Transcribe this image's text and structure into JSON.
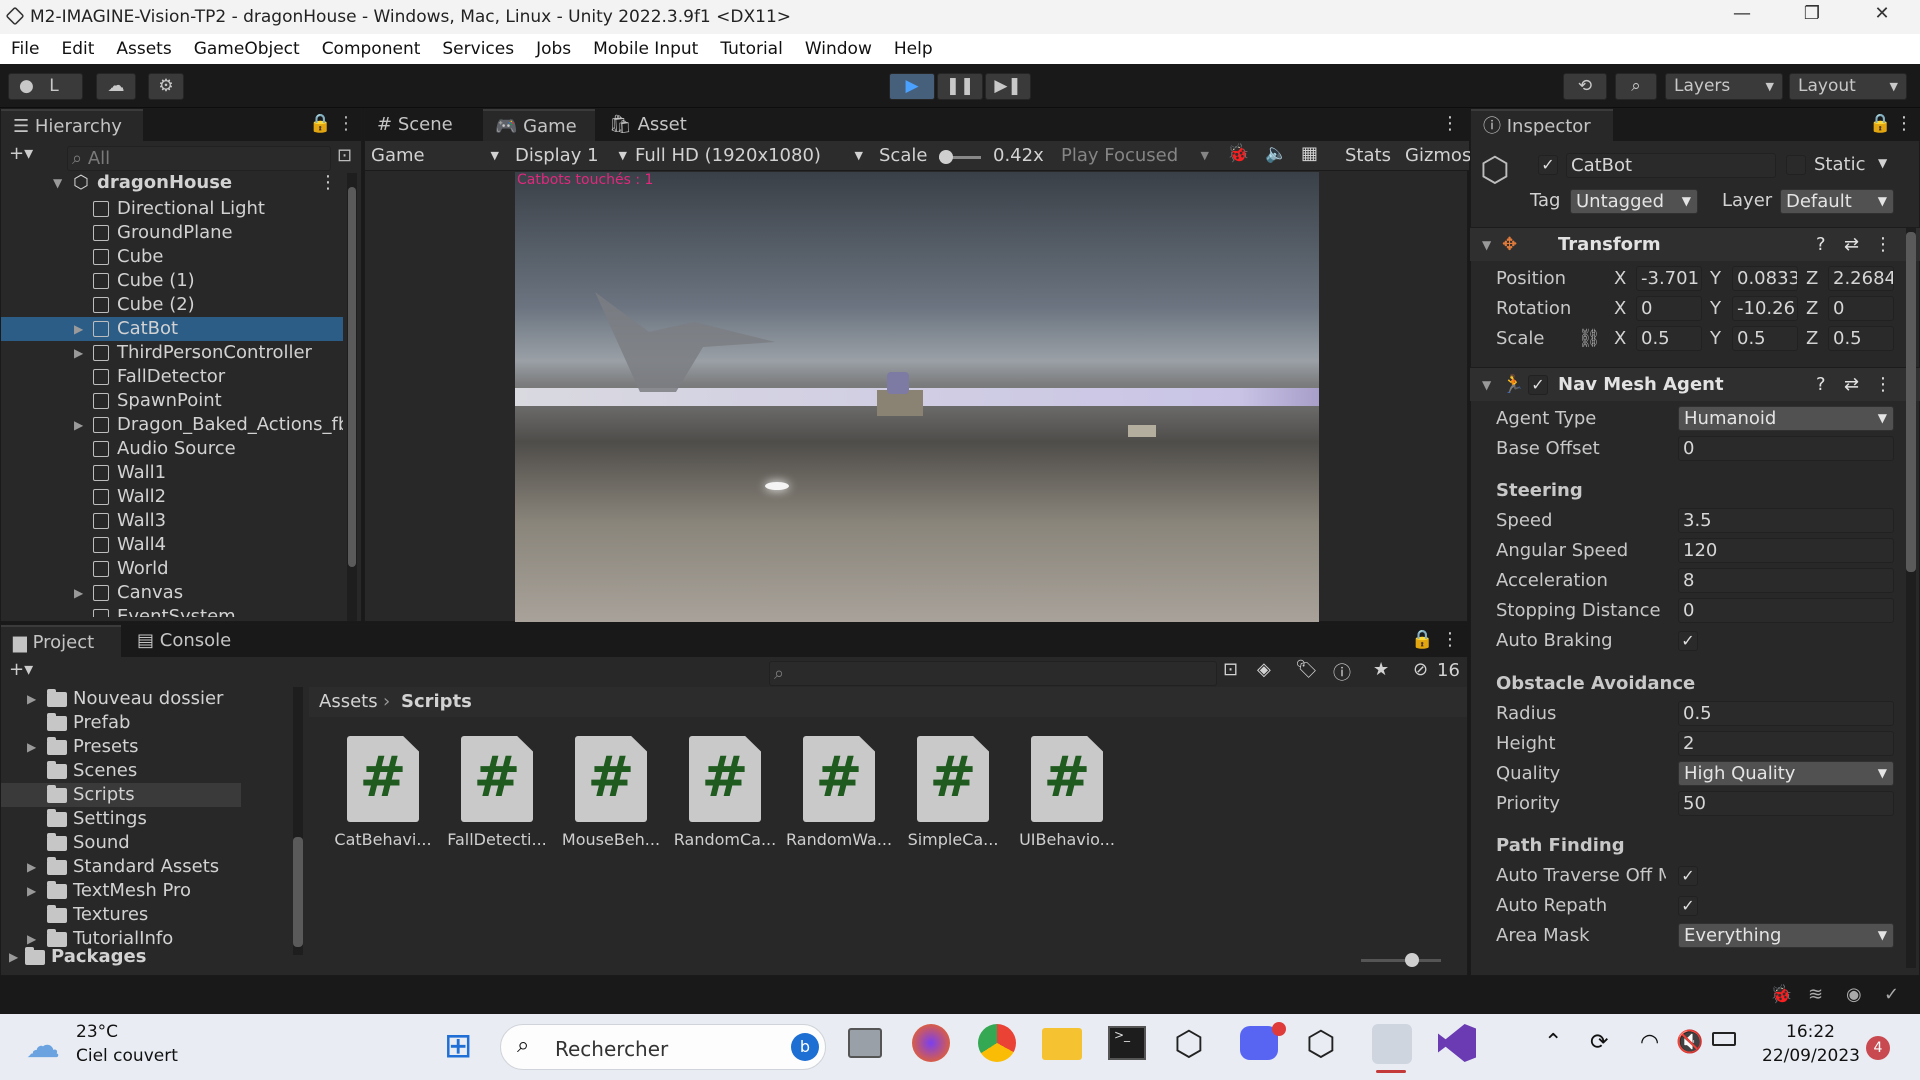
{
  "window": {
    "title": "M2-IMAGINE-Vision-TP2 - dragonHouse - Windows, Mac, Linux - Unity 2022.3.9f1 <DX11>",
    "minimize": "—",
    "maximize": "❐",
    "close": "✕"
  },
  "menu": [
    "File",
    "Edit",
    "Assets",
    "GameObject",
    "Component",
    "Services",
    "Jobs",
    "Mobile Input",
    "Tutorial",
    "Window",
    "Help"
  ],
  "toolbar": {
    "account": "L",
    "layers": "Layers",
    "layout": "Layout"
  },
  "hierarchy": {
    "tab": "Hierarchy",
    "search_placeholder": "All",
    "scene": "dragonHouse",
    "items": [
      {
        "label": "Directional Light"
      },
      {
        "label": "GroundPlane"
      },
      {
        "label": "Cube"
      },
      {
        "label": "Cube (1)"
      },
      {
        "label": "Cube (2)"
      },
      {
        "label": "CatBot"
      },
      {
        "label": "ThirdPersonController"
      },
      {
        "label": "FallDetector"
      },
      {
        "label": "SpawnPoint"
      },
      {
        "label": "Dragon_Baked_Actions_fb"
      },
      {
        "label": "Audio Source"
      },
      {
        "label": "Wall1"
      },
      {
        "label": "Wall2"
      },
      {
        "label": "Wall3"
      },
      {
        "label": "Wall4"
      },
      {
        "label": "World"
      },
      {
        "label": "Canvas"
      },
      {
        "label": "EventSystem"
      }
    ]
  },
  "center_tabs": {
    "scene": "Scene",
    "game": "Game",
    "asset_store": "Asset Store"
  },
  "game_toolbar": {
    "view": "Game",
    "display": "Display 1",
    "resolution": "Full HD (1920x1080)",
    "scale_label": "Scale",
    "scale_value": "0.42x",
    "play_mode": "Play Focused",
    "stats": "Stats",
    "gizmos": "Gizmos"
  },
  "game_view": {
    "hud_text": "Catbots touchés : 1"
  },
  "project": {
    "tab_project": "Project",
    "tab_console": "Console",
    "hidden_count": "16",
    "breadcrumb_root": "Assets",
    "breadcrumb_current": "Scripts",
    "folders": [
      {
        "label": "Nouveau dossier"
      },
      {
        "label": "Prefab"
      },
      {
        "label": "Presets"
      },
      {
        "label": "Scenes"
      },
      {
        "label": "Scripts"
      },
      {
        "label": "Settings"
      },
      {
        "label": "Sound"
      },
      {
        "label": "Standard Assets"
      },
      {
        "label": "TextMesh Pro"
      },
      {
        "label": "Textures"
      },
      {
        "label": "TutorialInfo"
      }
    ],
    "packages": "Packages",
    "scripts": [
      {
        "name": "CatBehavi..."
      },
      {
        "name": "FallDetecti..."
      },
      {
        "name": "MouseBeh..."
      },
      {
        "name": "RandomCa..."
      },
      {
        "name": "RandomWa..."
      },
      {
        "name": "SimpleCa..."
      },
      {
        "name": "UIBehavio..."
      }
    ]
  },
  "inspector": {
    "tab": "Inspector",
    "object_name": "CatBot",
    "static_label": "Static",
    "tag_label": "Tag",
    "tag_value": "Untagged",
    "layer_label": "Layer",
    "layer_value": "Default",
    "transform": {
      "header": "Transform",
      "position_label": "Position",
      "rotation_label": "Rotation",
      "scale_label": "Scale",
      "position": {
        "x": "-3.701",
        "y": "0.0833",
        "z": "2.2684"
      },
      "rotation": {
        "x": "0",
        "y": "-10.26",
        "z": "0"
      },
      "scale": {
        "x": "0.5",
        "y": "0.5",
        "z": "0.5"
      }
    },
    "navmesh": {
      "header": "Nav Mesh Agent",
      "agent_type_label": "Agent Type",
      "agent_type": "Humanoid",
      "base_offset_label": "Base Offset",
      "base_offset": "0",
      "steering": "Steering",
      "speed_label": "Speed",
      "speed": "3.5",
      "angular_speed_label": "Angular Speed",
      "angular_speed": "120",
      "acceleration_label": "Acceleration",
      "acceleration": "8",
      "stopping_distance_label": "Stopping Distance",
      "stopping_distance": "0",
      "auto_braking_label": "Auto Braking",
      "obstacle_avoidance": "Obstacle Avoidance",
      "radius_label": "Radius",
      "radius": "0.5",
      "height_label": "Height",
      "height": "2",
      "quality_label": "Quality",
      "quality": "High Quality",
      "priority_label": "Priority",
      "priority": "50",
      "path_finding": "Path Finding",
      "auto_traverse_label": "Auto Traverse Off Me",
      "auto_repath_label": "Auto Repath",
      "area_mask_label": "Area Mask",
      "area_mask": "Everything"
    }
  },
  "taskbar": {
    "weather_temp": "23°C",
    "weather_desc": "Ciel couvert",
    "search_placeholder": "Rechercher",
    "time": "16:22",
    "date": "22/09/2023",
    "notifications": "4"
  }
}
